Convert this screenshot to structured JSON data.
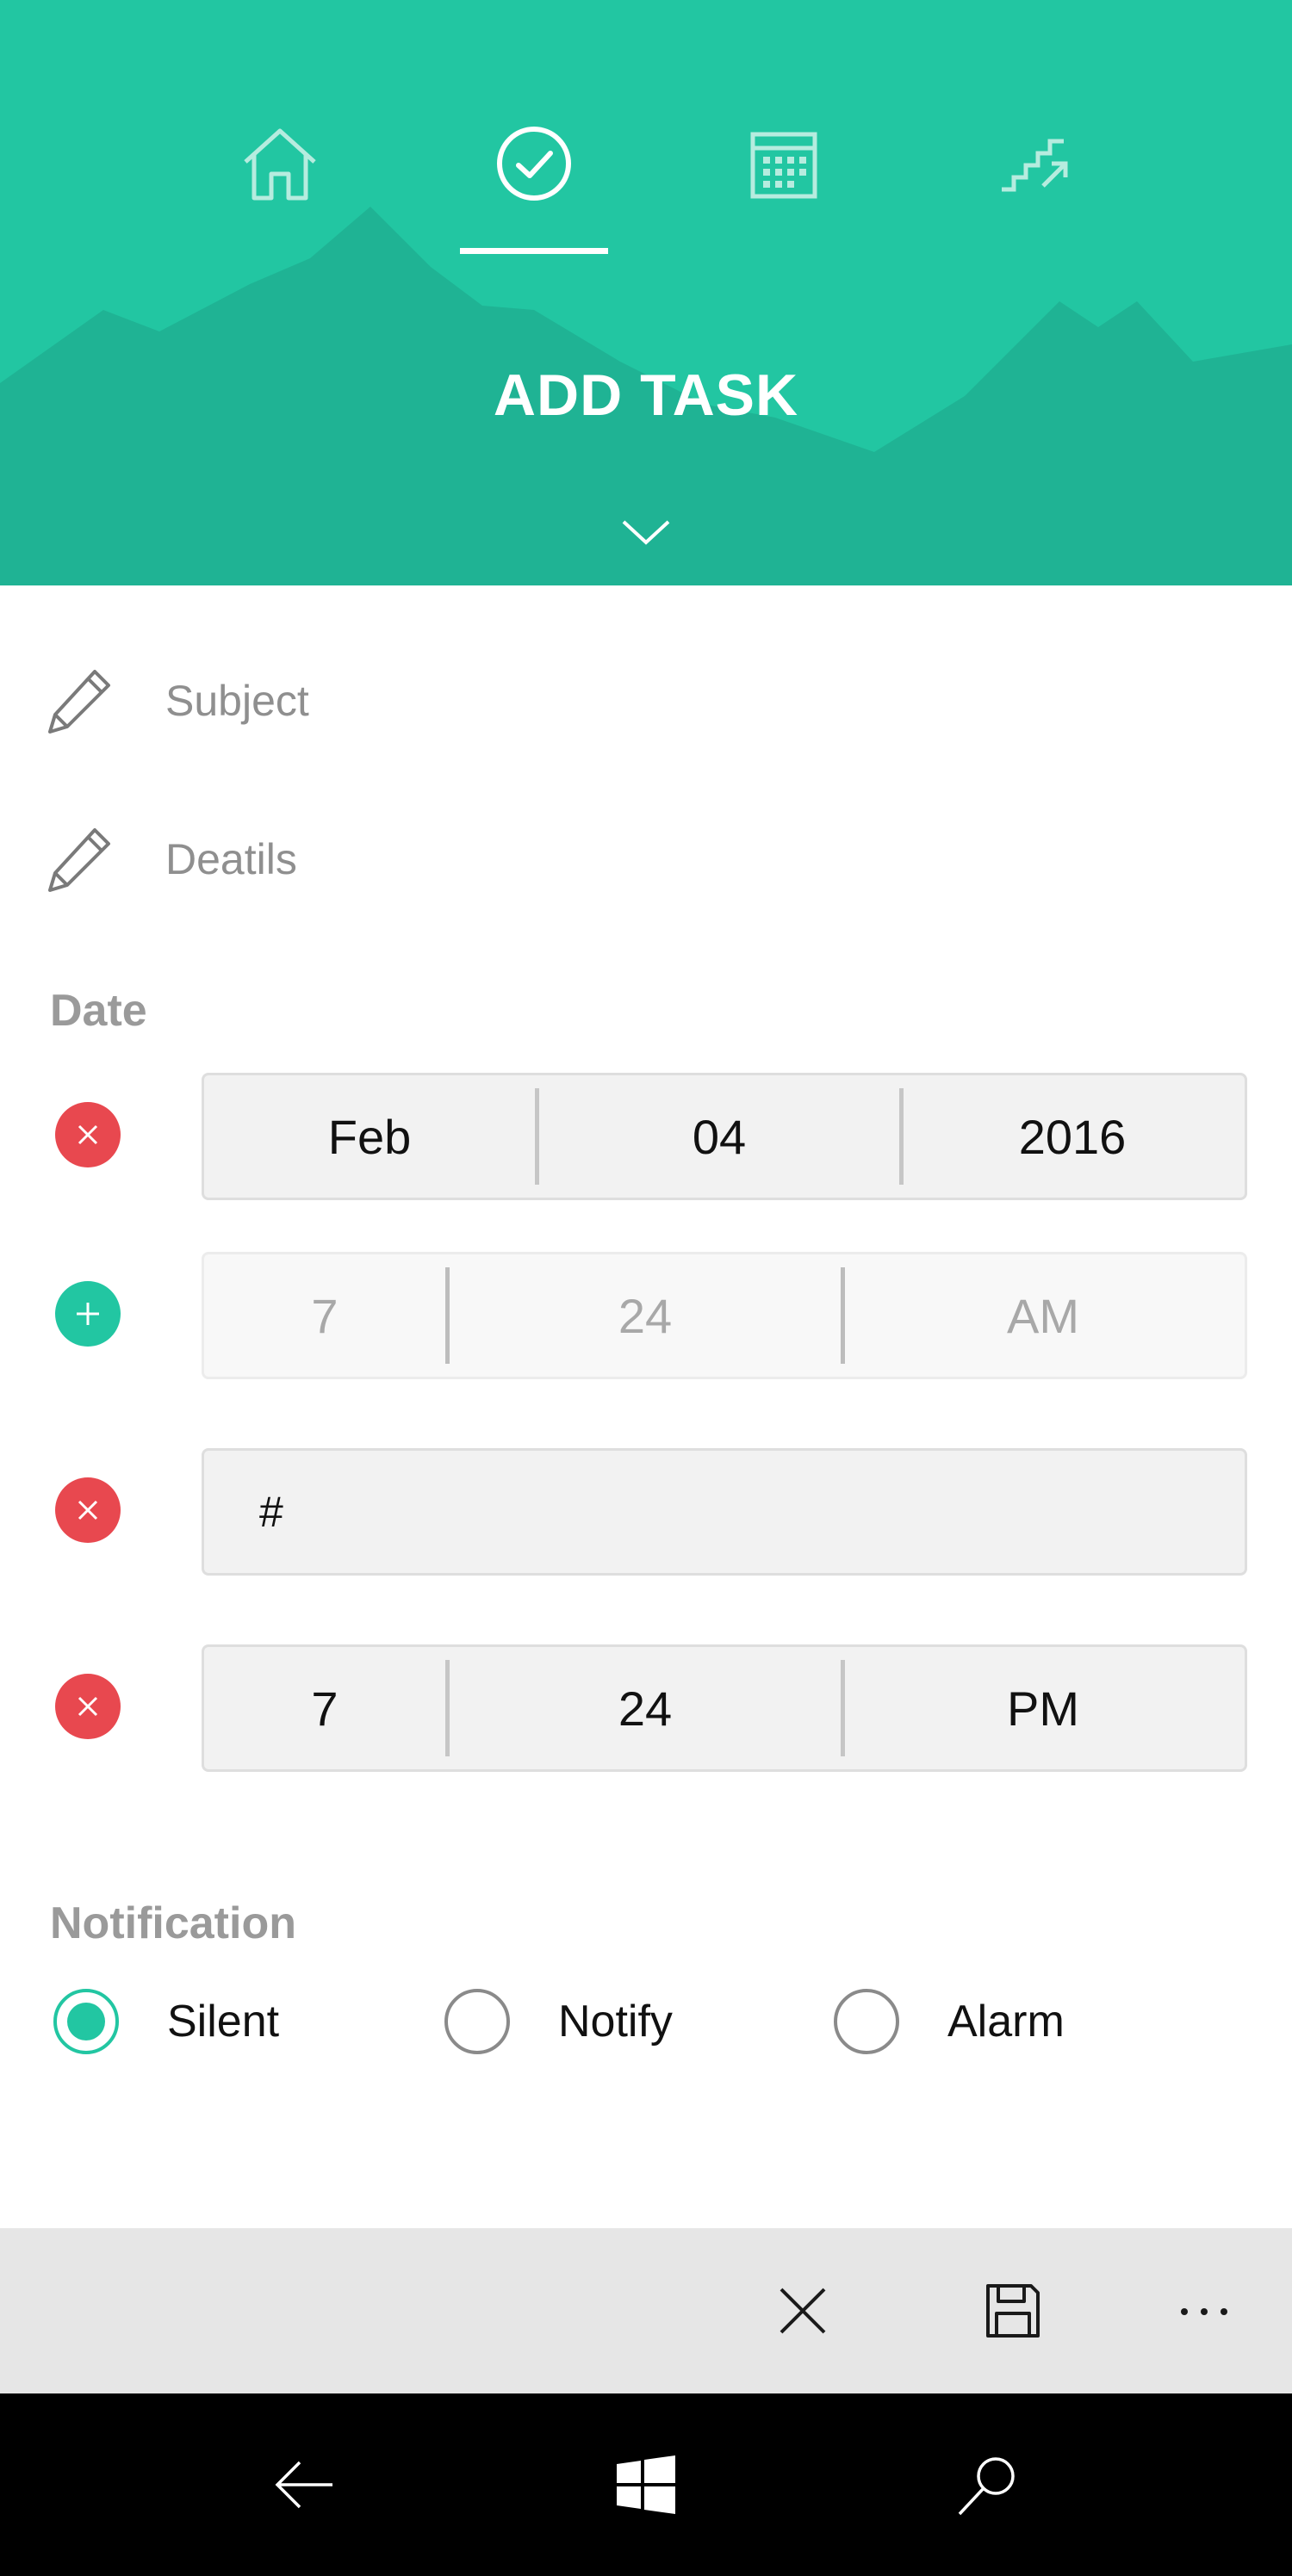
{
  "header": {
    "title": "ADD TASK",
    "tabs": [
      {
        "name": "home",
        "icon": "home-icon"
      },
      {
        "name": "tasks",
        "icon": "check-circle-icon",
        "active": true
      },
      {
        "name": "calendar",
        "icon": "calendar-icon"
      },
      {
        "name": "stats",
        "icon": "stairs-arrow-icon"
      }
    ],
    "colors": {
      "primary": "#22c6a2",
      "mountain": "#1fb394"
    }
  },
  "form": {
    "subject_placeholder": "Subject",
    "details_placeholder": "Deatils",
    "date_label": "Date",
    "date_picker": {
      "month": "Feb",
      "day": "04",
      "year": "2016"
    },
    "time_picker_disabled": {
      "hour": "7",
      "minute": "24",
      "period": "AM"
    },
    "text_input_value": "#",
    "time_picker": {
      "hour": "7",
      "minute": "24",
      "period": "PM"
    },
    "notification_label": "Notification",
    "notification_options": [
      {
        "label": "Silent",
        "selected": true
      },
      {
        "label": "Notify",
        "selected": false
      },
      {
        "label": "Alarm",
        "selected": false
      }
    ],
    "colors": {
      "remove": "#e8484f",
      "add": "#22c6a2"
    }
  },
  "appbar": {
    "buttons": [
      {
        "name": "cancel",
        "icon": "close-icon"
      },
      {
        "name": "save",
        "icon": "save-icon"
      },
      {
        "name": "more",
        "icon": "more-icon"
      }
    ]
  },
  "system_nav": {
    "buttons": [
      {
        "name": "back",
        "icon": "back-arrow-icon"
      },
      {
        "name": "start",
        "icon": "windows-icon"
      },
      {
        "name": "search",
        "icon": "search-icon"
      }
    ]
  }
}
